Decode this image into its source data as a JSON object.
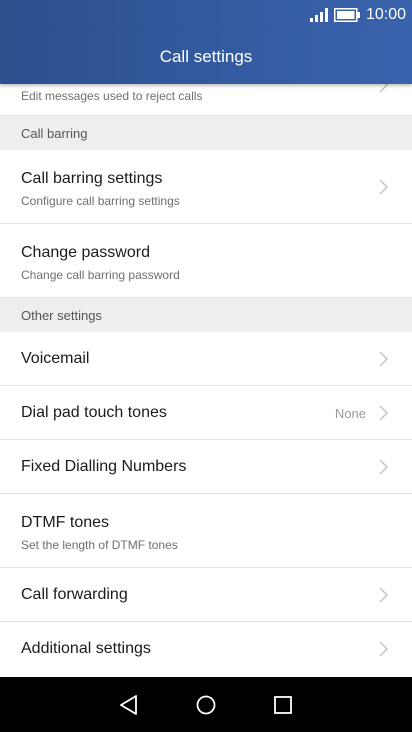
{
  "status_bar": {
    "time": "10:00",
    "icons": [
      "signal-icon",
      "battery-icon"
    ]
  },
  "app_bar": {
    "title": "Call settings"
  },
  "rows_top": {
    "partial_secondary": "Edit messages used to reject calls"
  },
  "sections": {
    "call_barring": "Call barring",
    "other_settings": "Other settings"
  },
  "call_barring_items": [
    {
      "primary": "Call barring settings",
      "secondary": "Configure call barring settings"
    },
    {
      "primary": "Change password",
      "secondary": "Change call barring password"
    }
  ],
  "other_items": [
    {
      "primary": "Voicemail"
    },
    {
      "primary": "Dial pad touch tones",
      "value": "None"
    },
    {
      "primary": "Fixed Dialling Numbers"
    },
    {
      "primary": "DTMF tones",
      "secondary": "Set the length of DTMF tones"
    },
    {
      "primary": "Call forwarding"
    },
    {
      "primary": "Additional settings"
    }
  ],
  "nav_bar": {
    "icons": [
      "back-icon",
      "home-icon",
      "recents-icon"
    ]
  }
}
